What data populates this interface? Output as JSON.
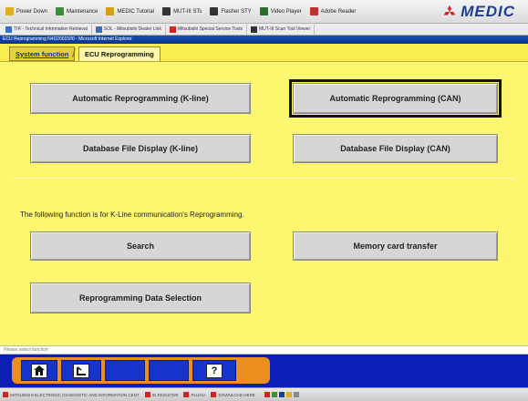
{
  "toolbar": {
    "items": [
      {
        "label": "Power Down",
        "icon": "power-icon",
        "color": "#e0b020"
      },
      {
        "label": "Maintenance",
        "icon": "wrench-icon",
        "color": "#3a8f3a"
      },
      {
        "label": "MEDIC Tutorial",
        "icon": "check-icon",
        "color": "#d4a017"
      },
      {
        "label": "MUT-III STs",
        "icon": "monitor-icon",
        "color": "#333333"
      },
      {
        "label": "Flasher STY",
        "icon": "monitor-icon",
        "color": "#333333"
      },
      {
        "label": "Video Player",
        "icon": "house-icon",
        "color": "#2a6b2a"
      },
      {
        "label": "Adobe Reader",
        "icon": "document-icon",
        "color": "#c03030"
      }
    ],
    "logo_text": "MEDIC"
  },
  "links": [
    {
      "label": "TIR - Technical Information Retrieval",
      "icon": "doc-icon",
      "color": "#3a6fbf"
    },
    {
      "label": "SOL - Mitsubishi Dealer Link",
      "icon": "doc-icon",
      "color": "#3a6fbf"
    },
    {
      "label": "Mitsubishi Special Service Tools",
      "icon": "diamond-icon",
      "color": "#d62222"
    },
    {
      "label": "MUT-III Scan Tool Viewer",
      "icon": "monitor-icon",
      "color": "#333333"
    }
  ],
  "window_title": "ECU Reprogramming N4D2001500 - Microsoft Internet Explorer",
  "tabs": {
    "system_function": "System function",
    "ecu_reprogramming": "ECU Reprogramming"
  },
  "buttons": {
    "auto_kline": "Automatic Reprogramming (K-line)",
    "auto_can": "Automatic Reprogramming (CAN)",
    "db_kline": "Database File Display (K-line)",
    "db_can": "Database File Display (CAN)",
    "search": "Search",
    "memory_card": "Memory card transfer",
    "repro_data": "Reprogramming Data Selection"
  },
  "kline_note": "The following function is for K-Line communication's Reprogramming.",
  "status_text": "Please select function",
  "nav": {
    "home_icon": "home-icon",
    "back_icon": "return-icon",
    "help_icon": "help-icon",
    "help_label": "?"
  },
  "taskbar": [
    "MITSUBISHI ELECTRONIC DIAGNOSTIC AND INFORMATION CENT",
    "ID REGISTER",
    "PLUGLI",
    "DOWNLOAD HERE"
  ],
  "colors": {
    "content_bg": "#fdf66f",
    "nav_bar": "#0c1fb5",
    "nav_tray": "#ec8f1e",
    "logo": "#1b3f93"
  }
}
